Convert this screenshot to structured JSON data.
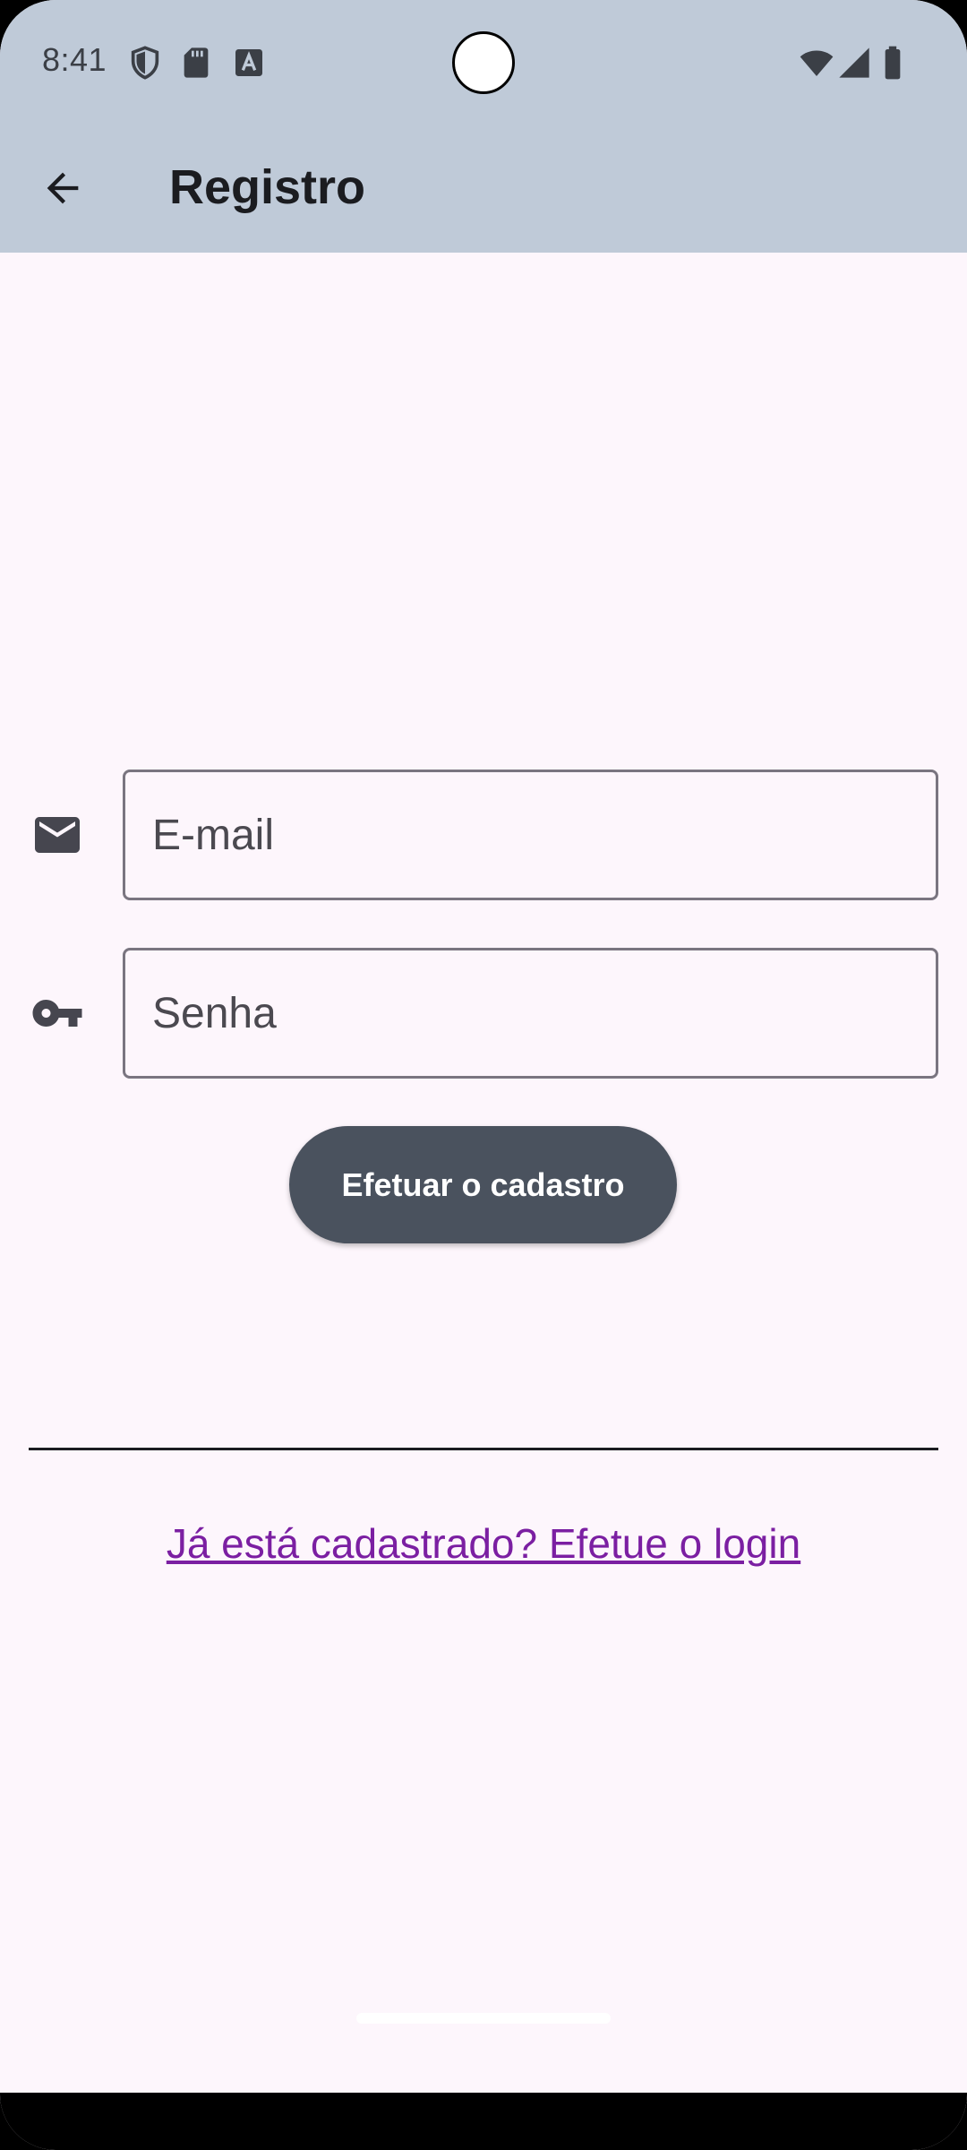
{
  "status_bar": {
    "time": "8:41",
    "left_icons": [
      "shield-icon",
      "sd-card-icon",
      "text-icon"
    ],
    "right_icons": [
      "wifi-icon",
      "cellular-icon",
      "battery-icon"
    ]
  },
  "app_bar": {
    "title": "Registro",
    "back_icon": "arrow-back-icon"
  },
  "form": {
    "email": {
      "placeholder": "E-mail",
      "value": "",
      "icon": "email-icon"
    },
    "password": {
      "placeholder": "Senha",
      "value": "",
      "icon": "key-icon"
    },
    "submit_label": "Efetuar o cadastro"
  },
  "footer": {
    "login_link": "Já está cadastrado? Efetue o login"
  },
  "colors": {
    "app_bar_bg": "#bfcad8",
    "page_bg": "#fdf6fc",
    "button_bg": "#4a525e",
    "link": "#7b1fa2"
  }
}
